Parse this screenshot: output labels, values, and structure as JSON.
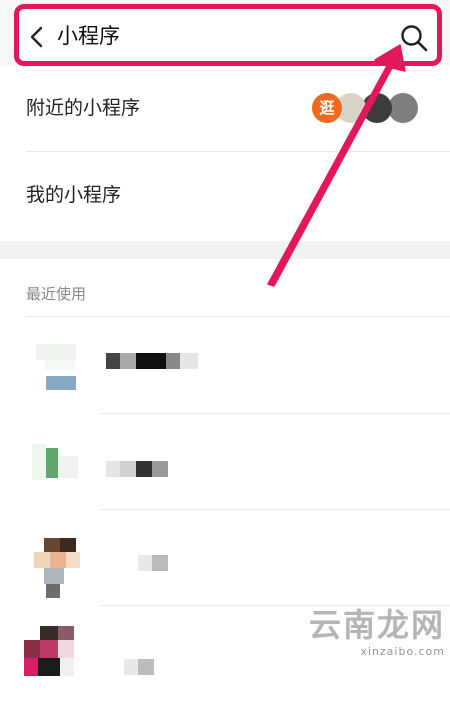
{
  "search": {
    "query": "小程序"
  },
  "menu": {
    "nearby_label": "附近的小程序",
    "nearby_thumb_text": "逛",
    "mine_label": "我的小程序"
  },
  "recent": {
    "title": "最近使用",
    "item_count": 4
  },
  "watermark": {
    "main": "云南龙网",
    "sub": "xinzaibo.com"
  },
  "colors": {
    "highlight": "#e2185b",
    "arrow": "#e2185b",
    "background": "#ffffff",
    "divider": "#e9e9e9"
  },
  "icons": {
    "back": "chevron-left-icon",
    "search": "search-icon",
    "annotation": "red-arrow-icon"
  }
}
